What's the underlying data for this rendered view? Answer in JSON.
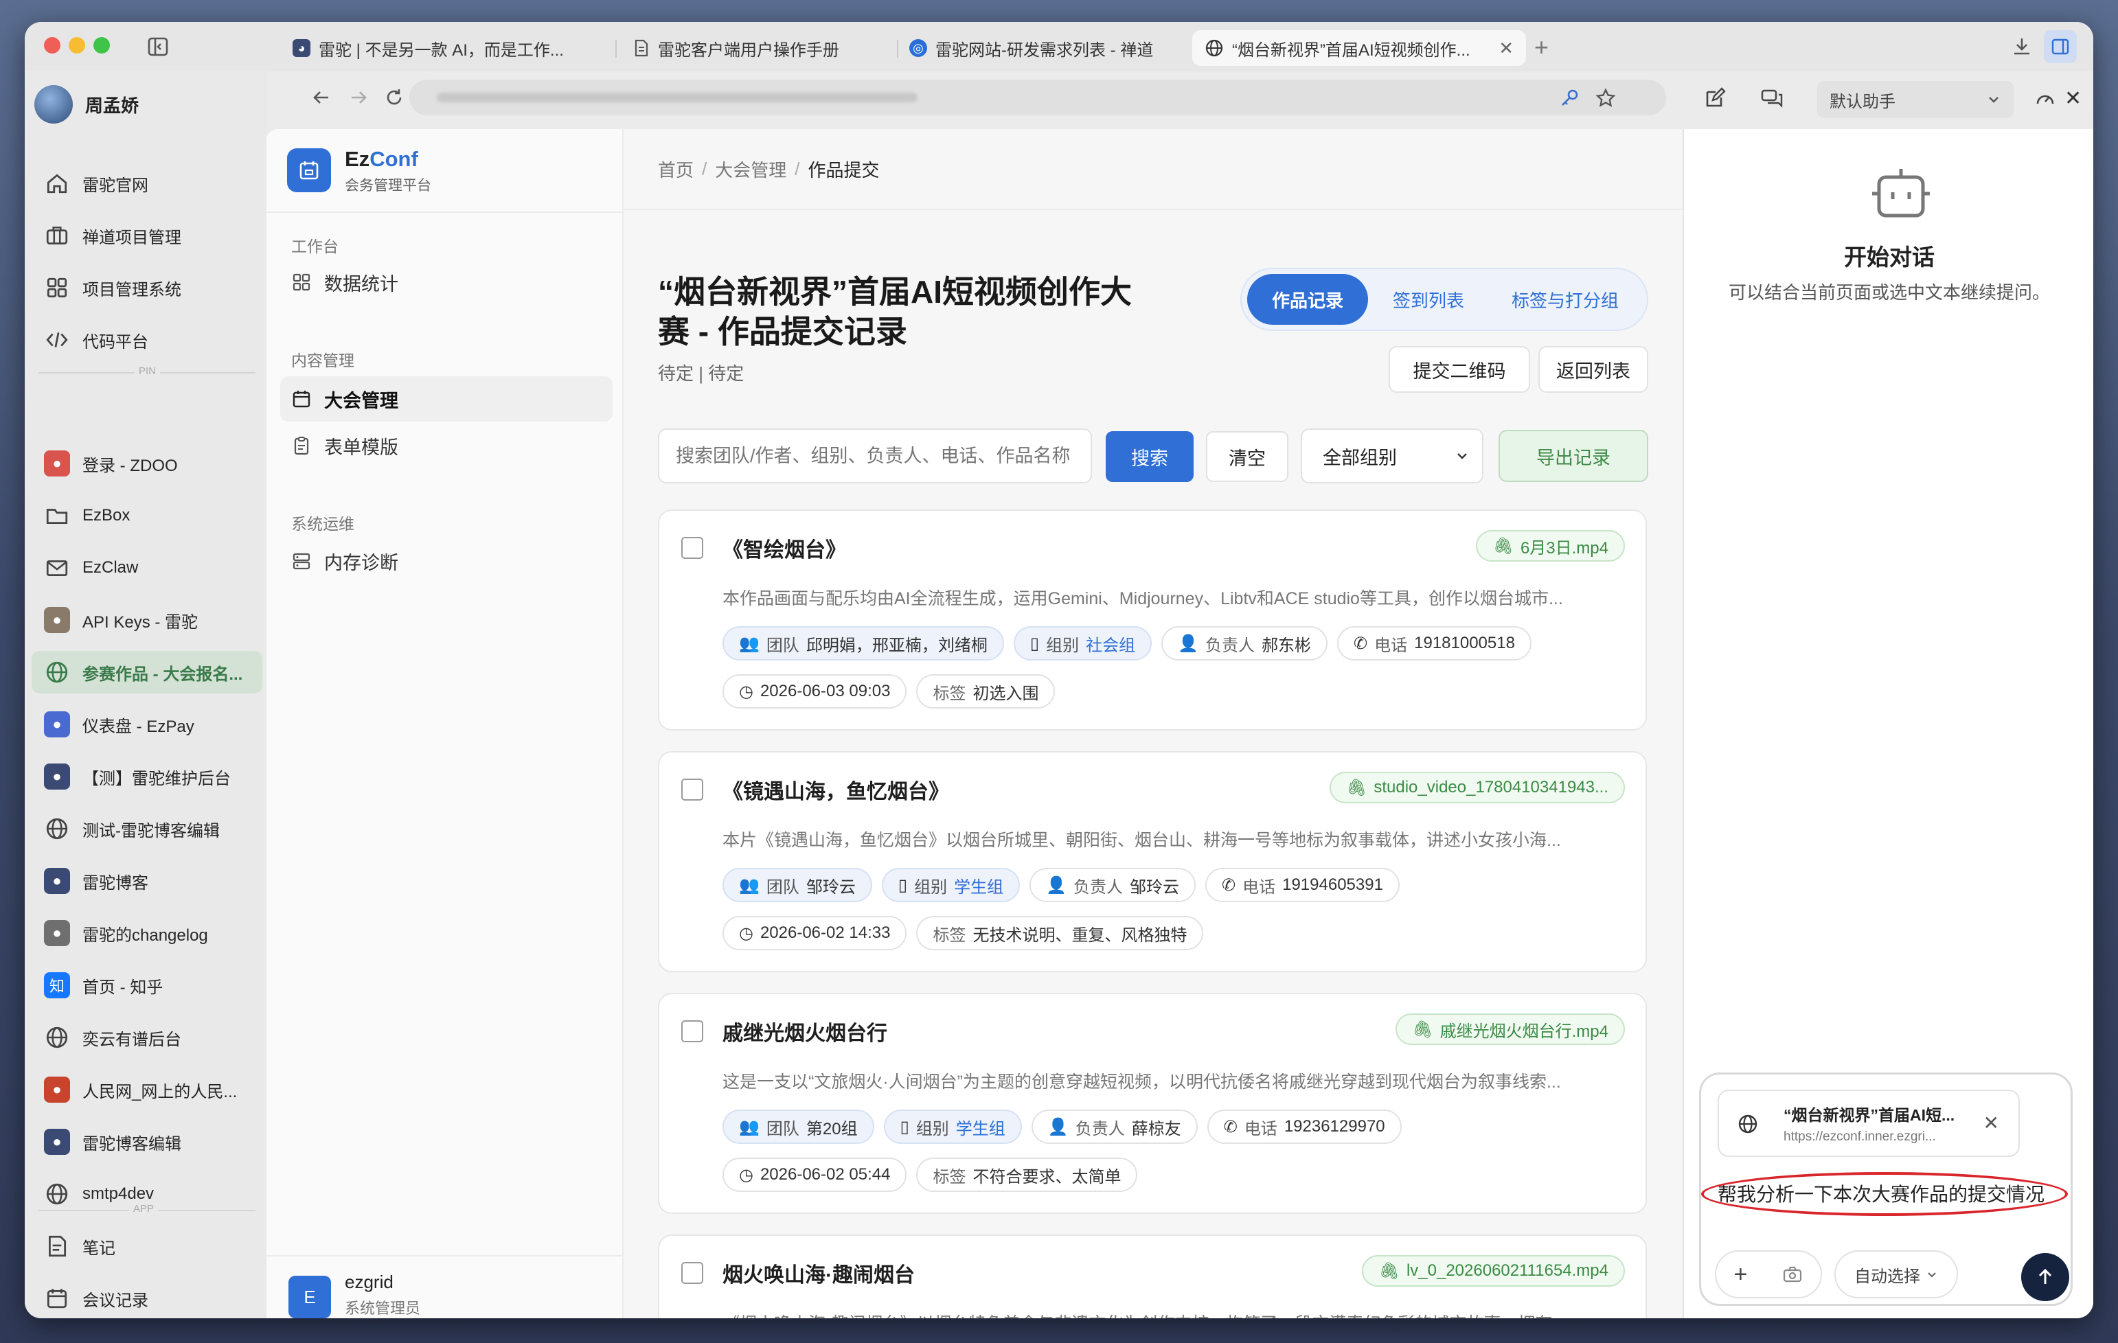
{
  "browser": {
    "tabs": [
      {
        "title": "雷驼 | 不是另一款 AI，而是工作..."
      },
      {
        "title": "雷驼客户端用户操作手册"
      },
      {
        "title": "雷驼网站-研发需求列表 - 禅道"
      },
      {
        "title": "“烟台新视界”首届AI短视频创作..."
      }
    ],
    "new_tab": "+"
  },
  "profile": {
    "name": "周孟娇"
  },
  "sidebar": {
    "items": [
      {
        "label": "雷驼官网",
        "icon": "home-icon"
      },
      {
        "label": "禅道项目管理",
        "icon": "briefcase-icon"
      },
      {
        "label": "项目管理系统",
        "icon": "grid-icon"
      },
      {
        "label": "代码平台",
        "icon": "code-icon"
      }
    ],
    "pin_label": "PIN",
    "pinned": [
      {
        "label": "登录 - ZDOO",
        "icon": "zdoo-icon",
        "color": "#d9534f"
      },
      {
        "label": "EzBox",
        "icon": "folder-icon"
      },
      {
        "label": "EzClaw",
        "icon": "mail-icon"
      },
      {
        "label": "API Keys - 雷驼",
        "icon": "camel-icon",
        "color": "#8a7a6a"
      },
      {
        "label": "参赛作品 - 大会报名...",
        "icon": "globe-icon",
        "selected": true
      },
      {
        "label": "仪表盘 - EzPay",
        "icon": "ezpay-icon",
        "color": "#4a6ad1"
      },
      {
        "label": "【测】雷驼维护后台",
        "icon": "avatar-icon",
        "color": "#3a4a72"
      },
      {
        "label": "测试-雷驼博客编辑",
        "icon": "globe-icon"
      },
      {
        "label": "雷驼博客",
        "icon": "avatar-icon",
        "color": "#3a4a72"
      },
      {
        "label": "雷驼的changelog",
        "icon": "camel-icon",
        "color": "#6f6f6f"
      },
      {
        "label": "首页 - 知乎",
        "icon": "zhihu-icon",
        "color": "#1677ff",
        "glyph": "知"
      },
      {
        "label": "奕云有谱后台",
        "icon": "globe-icon"
      },
      {
        "label": "人民网_网上的人民...",
        "icon": "people-icon",
        "color": "#c8442c"
      },
      {
        "label": "雷驼博客编辑",
        "icon": "avatar-icon",
        "color": "#3a4a72"
      },
      {
        "label": "smtp4dev",
        "icon": "globe-icon"
      }
    ],
    "app_label": "APP",
    "apps": [
      {
        "label": "笔记",
        "icon": "note-icon"
      },
      {
        "label": "会议记录",
        "icon": "calendar-icon"
      }
    ]
  },
  "app": {
    "brand": "EzConf",
    "brand_a": "Ez",
    "brand_b": "Conf",
    "subtitle": "会务管理平台",
    "nav": {
      "section1": "工作台",
      "item_stats": "数据统计",
      "section2": "内容管理",
      "item_conf": "大会管理",
      "item_forms": "表单模版",
      "section3": "系统运维",
      "item_mem": "内存诊断"
    },
    "user": {
      "initial": "E",
      "name": "ezgrid",
      "role": "系统管理员"
    }
  },
  "main": {
    "breadcrumb": [
      "首页",
      "大会管理",
      "作品提交"
    ],
    "sep": "/",
    "title_line1": "“烟台新视界”首届AI短视频创作大",
    "title_line2": "赛 - 作品提交记录",
    "status": "待定 | 待定",
    "tabs": [
      "作品记录",
      "签到列表",
      "标签与打分组"
    ],
    "btn_qrcode": "提交二维码",
    "btn_back": "返回列表",
    "search_placeholder": "搜索团队/作者、组别、负责人、电话、作品名称",
    "btn_search": "搜索",
    "btn_clear": "清空",
    "group_select": "全部组别",
    "btn_export": "导出记录",
    "labels": {
      "team": "团队",
      "group": "组别",
      "owner": "负责人",
      "phone": "电话",
      "tags": "标签"
    },
    "records": [
      {
        "title": "《智绘烟台》",
        "file": "6月3日.mp4",
        "desc": "本作品画面与配乐均由AI全流程生成，运用Gemini、Midjourney、Libtv和ACE studio等工具，创作以烟台城市...",
        "team": "邱明娟，邢亚楠，刘绪桐",
        "group": "社会组",
        "owner": "郝东彬",
        "phone": "19181000518",
        "time": "2026-06-03 09:03",
        "tags": "初选入围"
      },
      {
        "title": "《镜遇山海，鱼忆烟台》",
        "file": "studio_video_1780410341943...",
        "desc": "本片《镜遇山海，鱼忆烟台》以烟台所城里、朝阳街、烟台山、耕海一号等地标为叙事载体，讲述小女孩小海...",
        "team": "邹玲云",
        "group": "学生组",
        "owner": "邹玲云",
        "phone": "19194605391",
        "time": "2026-06-02 14:33",
        "tags": "无技术说明、重复、风格独特"
      },
      {
        "title": "戚继光烟火烟台行",
        "file": "戚继光烟火烟台行.mp4",
        "desc": "这是一支以“文旅烟火·人间烟台”为主题的创意穿越短视频，以明代抗倭名将戚继光穿越到现代烟台为叙事线索...",
        "team": "第20组",
        "group": "学生组",
        "owner": "薛椋友",
        "phone": "19236129970",
        "time": "2026-06-02 05:44",
        "tags": "不符合要求、太简单"
      },
      {
        "title": "烟火唤山海·趣闹烟台",
        "file": "lv_0_20260602111654.mp4",
        "desc": "《烟火唤山海·趣闹烟台》以烟台特色美食与非遗文化为创作内核，构筑了一段充满奇幻色彩的城市故事。拥有..."
      }
    ]
  },
  "assistant": {
    "select": "默认助手",
    "title": "开始对话",
    "hint": "可以结合当前页面或选中文本继续提问。",
    "ctx_title": "“烟台新视界”首届AI短...",
    "ctx_url": "https://ezconf.inner.ezgri...",
    "input": "帮我分析一下本次大赛作品的提交情况",
    "mode": "自动选择",
    "highlight_color": "#d9262c"
  }
}
